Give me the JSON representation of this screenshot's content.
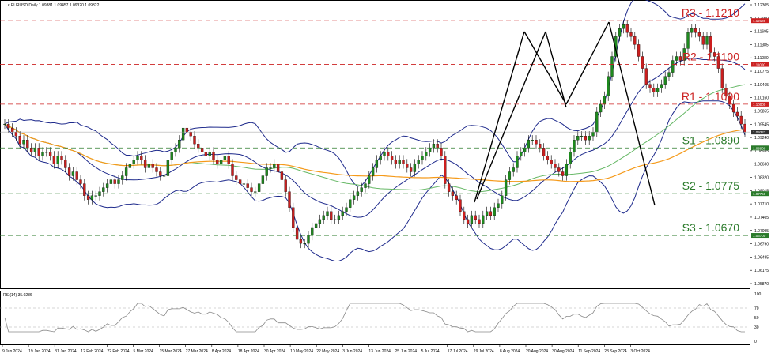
{
  "header": {
    "title": "EURUSD,Daily  1.09381 1.09457 1.09320 1.09322"
  },
  "rsi": {
    "label": "RSI(14) 35.0286",
    "levels": [
      30,
      70
    ],
    "ticks": [
      100,
      70,
      50,
      30,
      0
    ]
  },
  "colors": {
    "bull_candle": "#1e8a1e",
    "bear_candle": "#cc1e1e",
    "bollinger": "#1e2a8c",
    "ma_fast": "#66b866",
    "ma_slow": "#f59a1a",
    "resistance": "#cc2222",
    "support": "#2a7a2a",
    "pattern": "#000000",
    "rsi_line": "#8a8a8a"
  },
  "chart_data": [
    {
      "type": "candlestick",
      "title": "EURUSD,Daily  1.09381 1.09457 1.09320 1.09322",
      "xlabel": "",
      "ylabel": "",
      "ylim": [
        1.0537,
        1.1262
      ],
      "y_ticks": [
        "1.12305",
        "1.12000",
        "1.11695",
        "1.11385",
        "1.11080",
        "1.10775",
        "1.10465",
        "1.10160",
        "1.09855",
        "1.09545",
        "1.09240",
        "1.08935",
        "1.08630",
        "1.08320",
        "1.08015",
        "1.07710",
        "1.07405",
        "1.07095",
        "1.06790",
        "1.06485",
        "1.06175",
        "1.05870"
      ],
      "x_labels": [
        "9 Jan 2024",
        "19 Jan 2024",
        "31 Jan 2024",
        "12 Feb 2024",
        "22 Feb 2024",
        "5 Mar 2024",
        "15 Mar 2024",
        "27 Mar 2024",
        "8 Apr 2024",
        "18 Apr 2024",
        "30 Apr 2024",
        "10 May 2024",
        "22 May 2024",
        "3 Jun 2024",
        "13 Jun 2024",
        "25 Jun 2024",
        "5 Jul 2024",
        "17 Jul 2024",
        "29 Jul 2024",
        "8 Aug 2024",
        "20 Aug 2024",
        "30 Aug 2024",
        "11 Sep 2024",
        "23 Sep 2024",
        "3 Oct 2024"
      ],
      "current_price": "1.09322",
      "levels": [
        {
          "name": "R3",
          "label": "R3 - 1.1210",
          "value": 1.121,
          "kind": "resistance",
          "tag": "1.12100"
        },
        {
          "name": "R2",
          "label": "R2 - 1.1100",
          "value": 1.11,
          "kind": "resistance",
          "tag": "1.11000"
        },
        {
          "name": "R1",
          "label": "R1 - 1.1000",
          "value": 1.1,
          "kind": "resistance",
          "tag": "1.10000"
        },
        {
          "name": "S1",
          "label": "S1 - 1.0890",
          "value": 1.089,
          "kind": "support",
          "tag": "1.08900"
        },
        {
          "name": "S2",
          "label": "S2 - 1.0775",
          "value": 1.0775,
          "kind": "support",
          "tag": "1.07750"
        },
        {
          "name": "S3",
          "label": "S3 - 1.0670",
          "value": 1.067,
          "kind": "support",
          "tag": "1.06700"
        }
      ],
      "closes": [
        1.095,
        1.094,
        1.093,
        1.092,
        1.09,
        1.091,
        1.089,
        1.088,
        1.089,
        1.087,
        1.088,
        1.088,
        1.087,
        1.085,
        1.087,
        1.086,
        1.084,
        1.082,
        1.083,
        1.081,
        1.08,
        1.077,
        1.076,
        1.077,
        1.077,
        1.078,
        1.079,
        1.08,
        1.081,
        1.08,
        1.081,
        1.082,
        1.084,
        1.085,
        1.086,
        1.087,
        1.086,
        1.084,
        1.085,
        1.084,
        1.083,
        1.082,
        1.082,
        1.086,
        1.088,
        1.089,
        1.091,
        1.094,
        1.093,
        1.092,
        1.09,
        1.089,
        1.088,
        1.087,
        1.088,
        1.086,
        1.085,
        1.086,
        1.087,
        1.085,
        1.082,
        1.081,
        1.08,
        1.08,
        1.079,
        1.078,
        1.078,
        1.08,
        1.082,
        1.084,
        1.084,
        1.085,
        1.083,
        1.081,
        1.078,
        1.074,
        1.069,
        1.066,
        1.065,
        1.065,
        1.067,
        1.069,
        1.07,
        1.071,
        1.072,
        1.073,
        1.071,
        1.071,
        1.072,
        1.073,
        1.074,
        1.076,
        1.077,
        1.078,
        1.079,
        1.08,
        1.082,
        1.084,
        1.086,
        1.087,
        1.088,
        1.087,
        1.086,
        1.085,
        1.086,
        1.085,
        1.084,
        1.083,
        1.085,
        1.086,
        1.087,
        1.088,
        1.089,
        1.09,
        1.089,
        1.087,
        1.08,
        1.078,
        1.077,
        1.076,
        1.073,
        1.071,
        1.07,
        1.072,
        1.071,
        1.07,
        1.072,
        1.073,
        1.072,
        1.074,
        1.075,
        1.077,
        1.081,
        1.083,
        1.084,
        1.087,
        1.088,
        1.089,
        1.091,
        1.091,
        1.09,
        1.089,
        1.087,
        1.086,
        1.085,
        1.084,
        1.083,
        1.082,
        1.085,
        1.088,
        1.091,
        1.092,
        1.092,
        1.091,
        1.092,
        1.093,
        1.098,
        1.1,
        1.102,
        1.107,
        1.112,
        1.117,
        1.119,
        1.12,
        1.118,
        1.117,
        1.115,
        1.112,
        1.109,
        1.105,
        1.104,
        1.103,
        1.104,
        1.105,
        1.107,
        1.108,
        1.111,
        1.112,
        1.111,
        1.114,
        1.118,
        1.119,
        1.118,
        1.117,
        1.115,
        1.117,
        1.113,
        1.112,
        1.109,
        1.104,
        1.102,
        1.1,
        1.098,
        1.097,
        1.095,
        1.093
      ]
    },
    {
      "type": "line",
      "title": "RSI(14) 35.0286",
      "xlabel": "",
      "ylabel": "",
      "ylim": [
        0,
        100
      ],
      "series": [
        {
          "name": "RSI(14)",
          "values": []
        }
      ]
    }
  ]
}
